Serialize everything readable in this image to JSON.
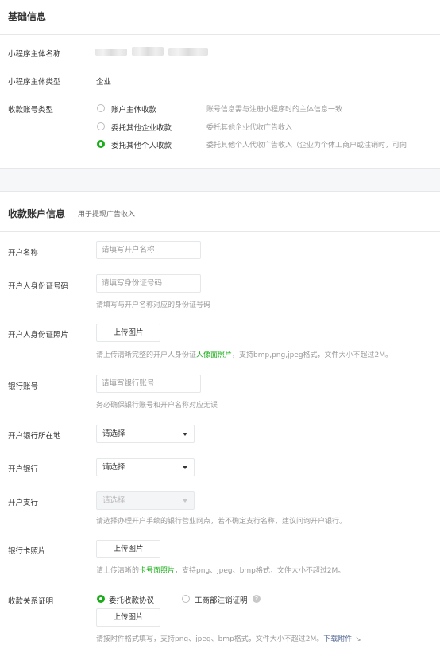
{
  "basic": {
    "title": "基础信息",
    "subject_name_label": "小程序主体名称",
    "subject_type_label": "小程序主体类型",
    "subject_type_value": "企业",
    "account_type_label": "收款账号类型",
    "options": [
      {
        "label": "账户主体收款",
        "desc": "账号信息需与注册小程序时的主体信息一致",
        "checked": false
      },
      {
        "label": "委托其他企业收款",
        "desc": "委托其他企业代收广告收入",
        "checked": false
      },
      {
        "label": "委托其他个人收款",
        "desc": "委托其他个人代收广告收入（企业为个体工商户或注销时，可向",
        "checked": true
      }
    ]
  },
  "account": {
    "title": "收款账户信息",
    "subtitle": "用于提现广告收入",
    "holder_name": {
      "label": "开户名称",
      "placeholder": "请填写开户名称"
    },
    "id_number": {
      "label": "开户人身份证号码",
      "placeholder": "请填写身份证号码",
      "hint": "请填写与开户名称对应的身份证号码"
    },
    "id_photo": {
      "label": "开户人身份证照片",
      "button": "上传图片",
      "hint_pre": "请上传清晰完整的开户人身份证",
      "hint_link": "人像面照片",
      "hint_post": "，支持bmp,png,jpeg格式，文件大小不超过2M。"
    },
    "bank_account": {
      "label": "银行账号",
      "placeholder": "请填写银行账号",
      "hint": "务必确保银行账号和开户名称对应无误"
    },
    "bank_region": {
      "label": "开户银行所在地",
      "value": "请选择"
    },
    "bank": {
      "label": "开户银行",
      "value": "请选择"
    },
    "branch": {
      "label": "开户支行",
      "value": "请选择",
      "hint": "请选择办理开户手续的银行营业网点，若不确定支行名称，建议问询开户银行。"
    },
    "card_photo": {
      "label": "银行卡照片",
      "button": "上传图片",
      "hint_pre": "请上传清晰的",
      "hint_link": "卡号面照片",
      "hint_post": "，支持png、jpeg、bmp格式，文件大小不超过2M。"
    },
    "proof": {
      "label": "收款关系证明",
      "option1": "委托收款协议",
      "option1_checked": true,
      "option2": "工商部注销证明",
      "option2_checked": false,
      "help": "?",
      "button": "上传图片",
      "hint_pre": "请按附件格式填写，支持png、jpeg、bmp格式，文件大小不超过2M。",
      "hint_link": "下载附件",
      "hint_tail": "↘"
    }
  },
  "colors": {
    "accent": "#1aad19",
    "link_blue": "#576b95"
  }
}
